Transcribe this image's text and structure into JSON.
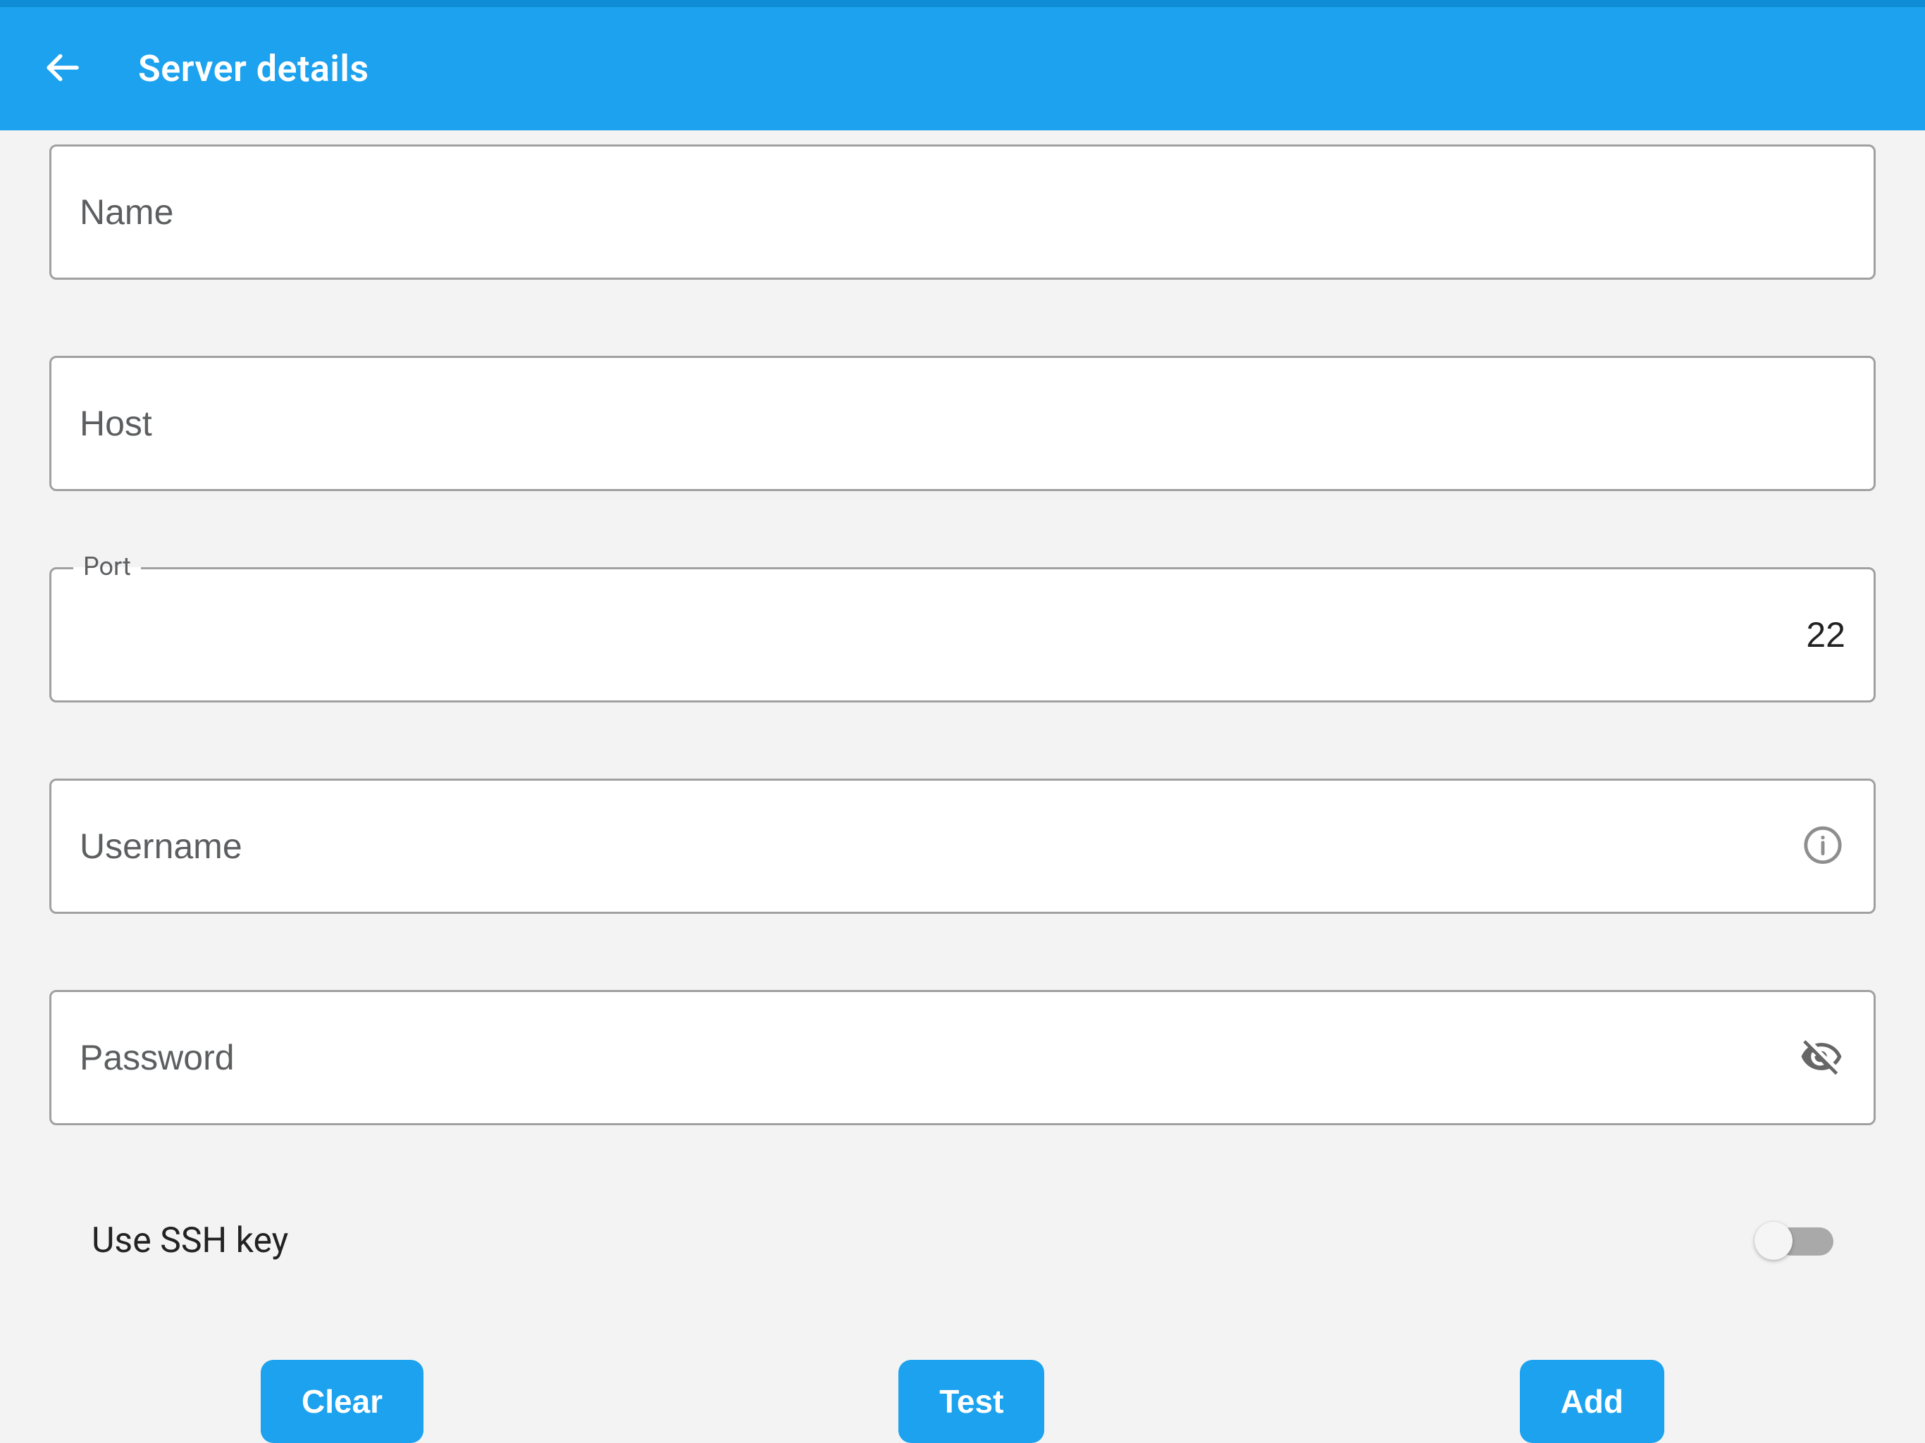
{
  "header": {
    "back_icon": "arrow-back",
    "title": "Server details"
  },
  "form": {
    "name": {
      "placeholder": "Name",
      "value": ""
    },
    "host": {
      "placeholder": "Host",
      "value": ""
    },
    "port": {
      "label": "Port",
      "value": "22"
    },
    "username": {
      "placeholder": "Username",
      "value": "",
      "info_icon": "info"
    },
    "password": {
      "placeholder": "Password",
      "value": "",
      "visibility_icon": "visibility-off"
    },
    "ssh_key": {
      "label": "Use SSH key",
      "enabled": false
    }
  },
  "actions": {
    "clear": "Clear",
    "test": "Test",
    "add": "Add"
  },
  "colors": {
    "primary": "#1ca2ee",
    "primary_dark": "#0e8cd6",
    "border": "#9fa19f",
    "bg": "#f3f3f3",
    "text_muted": "#5c5e60",
    "icon_muted": "#757575"
  }
}
